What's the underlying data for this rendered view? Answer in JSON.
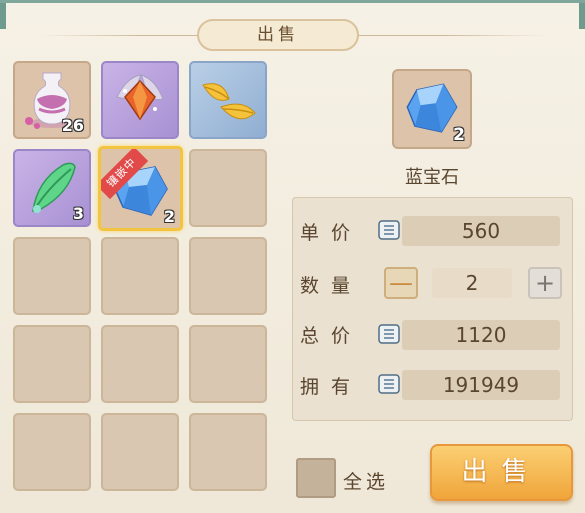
{
  "title": "出售",
  "inventory": {
    "slots": [
      {
        "icon": "vase-icon",
        "count": "26"
      },
      {
        "icon": "gem-ornament-icon",
        "count": ""
      },
      {
        "icon": "golden-feather-icon",
        "count": ""
      },
      {
        "icon": "green-feather-icon",
        "count": "3"
      },
      {
        "icon": "sapphire-icon",
        "count": "2",
        "badge": "镶嵌中"
      }
    ]
  },
  "detail": {
    "icon": "sapphire-icon",
    "count": "2",
    "name": "蓝宝石"
  },
  "price_panel": {
    "unit_price_label": "单价",
    "unit_price": "560",
    "quantity_label": "数量",
    "quantity": "2",
    "minus_label": "—",
    "plus_label": "+",
    "total_label": "总价",
    "total": "1120",
    "owned_label": "拥有",
    "owned": "191949"
  },
  "footer": {
    "select_all_label": "全选",
    "sell_button_label": "出售"
  }
}
